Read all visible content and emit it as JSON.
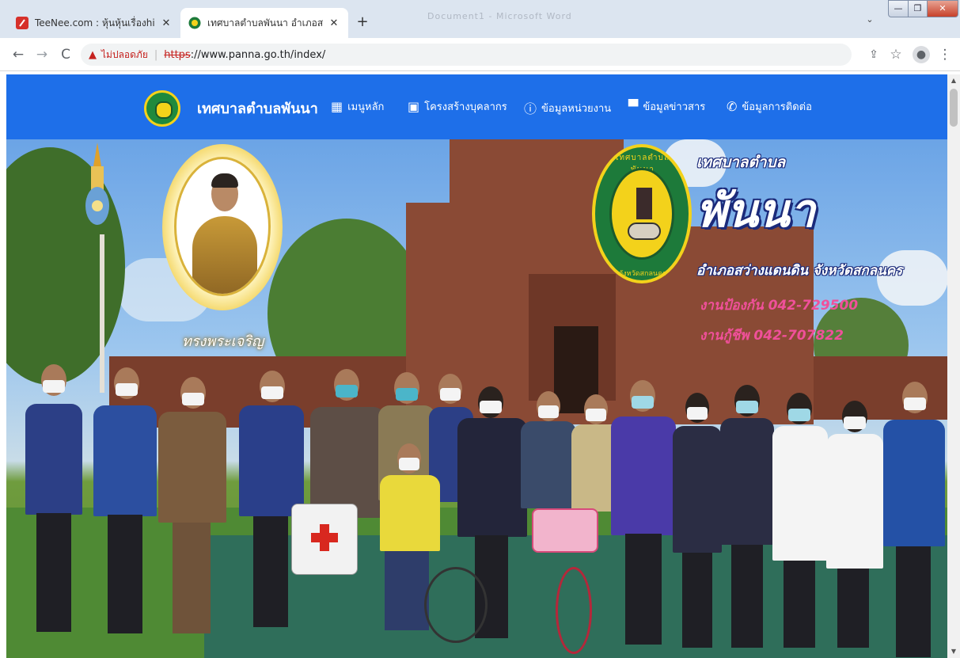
{
  "tabs": [
    {
      "title": "TeeNee.com : หุ้นหุ้นเรื่องhit อัพเดท",
      "icon": "teenee-favicon",
      "active": false
    },
    {
      "title": "เทศบาลตำบลพันนา อำเภอสว่างแดนดิน",
      "icon": "panna-favicon",
      "active": true
    }
  ],
  "window": {
    "ghost_title": "Document1 - Microsoft Word",
    "tab_search_glyph": "⌄",
    "minimize_glyph": "—",
    "maximize_glyph": "❐",
    "close_glyph": "✕",
    "newtab_glyph": "+",
    "tab_close_glyph": "✕"
  },
  "toolbar": {
    "back_glyph": "←",
    "forward_glyph": "→",
    "reload_glyph": "C",
    "warning_glyph": "▲",
    "security_label": "ไม่ปลอดภัย",
    "url_scheme": "https",
    "url_rest": "://www.panna.go.th/index/",
    "share_glyph": "⇪",
    "bookmark_glyph": "☆",
    "profile_glyph": "●",
    "menu_glyph": "⋮"
  },
  "site": {
    "name": "เทศบาลตำบลพันนา",
    "nav": [
      {
        "label": "เมนูหลัก",
        "icon": "grid-icon",
        "glyph": "▦"
      },
      {
        "label": "โครงสร้างบุคลากร",
        "icon": "calendar-icon",
        "glyph": "▣"
      },
      {
        "label": "ข้อมูลหน่วยงาน",
        "icon": "info-icon",
        "glyph": "ⓘ"
      },
      {
        "label": "ข้อมูลข่าวสาร",
        "icon": "chat-icon",
        "glyph": "▀"
      },
      {
        "label": "ข้อมูลการติดต่อ",
        "icon": "phone-icon",
        "glyph": "✆"
      }
    ]
  },
  "hero": {
    "line1": "เทศบาลตำบล",
    "line2": "พันนา",
    "line3": "อำเภอสว่างแดนดิน จังหวัดสกลนคร",
    "line4": "งานป้องกัน 042-729500",
    "line5": "งานกู้ชีพ 042-707822",
    "portrait_caption": "ทรงพระเจริญ",
    "seal_top": "เทศบาลตำบลพันนา",
    "seal_bottom": "จังหวัดสกลนคร"
  },
  "scrollbar": {
    "up_glyph": "▲",
    "down_glyph": "▼"
  },
  "colors": {
    "navbar": "#1e6fe9",
    "warning": "#c5221f",
    "hero_pink": "#f0509a",
    "hero_outline": "#1b2a7a",
    "seal_green": "#1d7a3a",
    "seal_gold": "#f3d21b"
  }
}
